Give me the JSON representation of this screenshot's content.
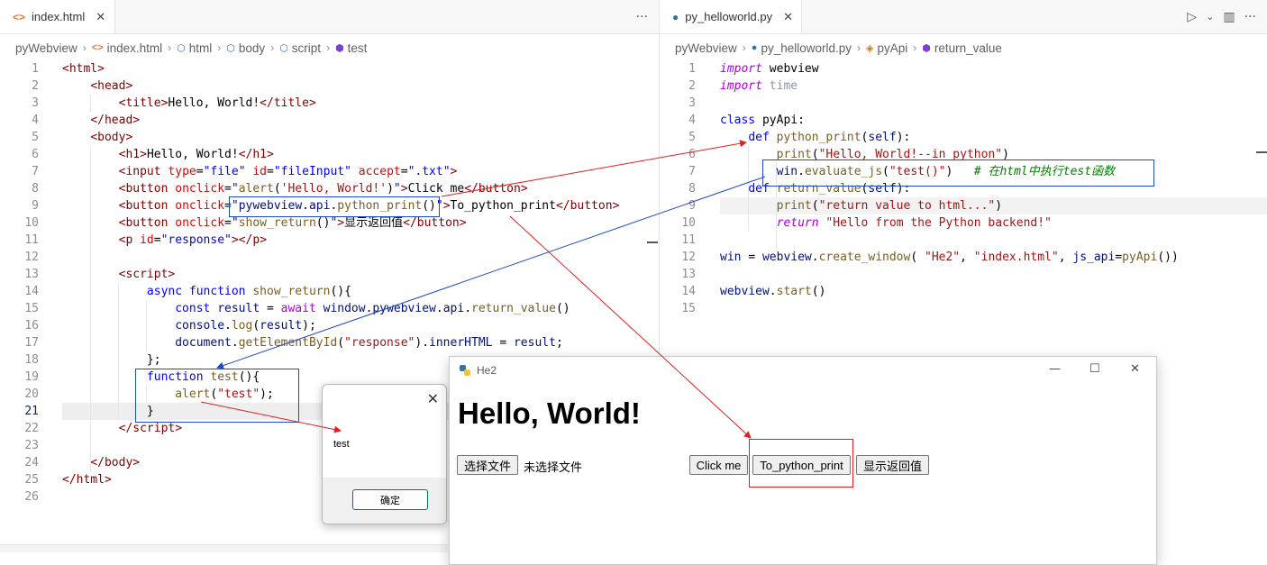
{
  "left_editor": {
    "tab": {
      "icon": "html-file-icon",
      "label": "index.html",
      "close": "✕"
    },
    "more_actions": "···",
    "breadcrumb": [
      "pyWebview",
      "index.html",
      "html",
      "body",
      "script",
      "test"
    ],
    "lines": [
      {
        "n": "1",
        "html": "<span class=\"p\">&lt;</span><span class=\"t\">html</span><span class=\"p\">&gt;</span>"
      },
      {
        "n": "2",
        "html": "    <span class=\"p\">&lt;</span><span class=\"t\">head</span><span class=\"p\">&gt;</span>"
      },
      {
        "n": "3",
        "html": "        <span class=\"p\">&lt;</span><span class=\"t\">title</span><span class=\"p\">&gt;</span><span class=\"d\">Hello, World!</span><span class=\"p\">&lt;/</span><span class=\"t\">title</span><span class=\"p\">&gt;</span>"
      },
      {
        "n": "4",
        "html": "    <span class=\"p\">&lt;/</span><span class=\"t\">head</span><span class=\"p\">&gt;</span>"
      },
      {
        "n": "5",
        "html": "    <span class=\"p\">&lt;</span><span class=\"t\">body</span><span class=\"p\">&gt;</span>"
      },
      {
        "n": "6",
        "html": "        <span class=\"p\">&lt;</span><span class=\"t\">h1</span><span class=\"p\">&gt;</span><span class=\"d\">Hello, World!</span><span class=\"p\">&lt;/</span><span class=\"t\">h1</span><span class=\"p\">&gt;</span>"
      },
      {
        "n": "7",
        "html": "        <span class=\"p\">&lt;</span><span class=\"t\">input</span> <span class=\"a\">type</span><span class=\"d\">=</span><span class=\"k\">\"file\"</span> <span class=\"a\">id</span><span class=\"d\">=</span><span class=\"k\">\"fileInput\"</span> <span class=\"a\">accept</span><span class=\"d\">=</span><span class=\"k\">\".txt\"</span><span class=\"p\">&gt;</span>"
      },
      {
        "n": "8",
        "html": "        <span class=\"p\">&lt;</span><span class=\"t\">button</span> <span class=\"a\">onclick</span><span class=\"d\">=</span><span class=\"k\">\"</span><span class=\"f\">alert</span><span class=\"d\">(</span><span class=\"s\">'Hello, World!'</span><span class=\"d\">)</span><span class=\"k\">\"</span><span class=\"p\">&gt;</span><span class=\"d\">Click me</span><span class=\"p\">&lt;/</span><span class=\"t\">button</span><span class=\"p\">&gt;</span>"
      },
      {
        "n": "9",
        "html": "        <span class=\"p\">&lt;</span><span class=\"t\">button</span> <span class=\"a\">onclick</span><span class=\"d\">=</span><span class=\"k\">\"</span><span class=\"v\">pywebview</span><span class=\"d\">.</span><span class=\"v\">api</span><span class=\"d\">.</span><span class=\"f\">python_print</span><span class=\"d\">()</span><span class=\"k\">\"</span><span class=\"p\">&gt;</span><span class=\"d\">To_python_print</span><span class=\"p\">&lt;/</span><span class=\"t\">button</span><span class=\"p\">&gt;</span>"
      },
      {
        "n": "10",
        "html": "        <span class=\"p\">&lt;</span><span class=\"t\">button</span> <span class=\"a\">onclick</span><span class=\"d\">=</span><span class=\"k\">\"</span><span class=\"f\">show_return</span><span class=\"d\">()</span><span class=\"k\">\"</span><span class=\"p\">&gt;</span><span class=\"d\">显示返回值</span><span class=\"p\">&lt;/</span><span class=\"t\">button</span><span class=\"p\">&gt;</span>"
      },
      {
        "n": "11",
        "html": "        <span class=\"p\">&lt;</span><span class=\"t\">p</span> <span class=\"a\">id</span><span class=\"d\">=</span><span class=\"k\">\"response\"</span><span class=\"p\">&gt;&lt;/</span><span class=\"t\">p</span><span class=\"p\">&gt;</span>"
      },
      {
        "n": "12",
        "html": ""
      },
      {
        "n": "13",
        "html": "        <span class=\"p\">&lt;</span><span class=\"t\">script</span><span class=\"p\">&gt;</span>"
      },
      {
        "n": "14",
        "html": "            <span class=\"k\">async</span> <span class=\"k\">function</span> <span class=\"f\">show_return</span><span class=\"d\">(){</span>"
      },
      {
        "n": "15",
        "html": "                <span class=\"k\">const</span> <span class=\"v\">result</span> <span class=\"d\">=</span> <span class=\"kp\" style=\"font-style:normal\">await</span> <span class=\"v\">window</span><span class=\"d\">.</span><span class=\"v\">pywebview</span><span class=\"d\">.</span><span class=\"v\">api</span><span class=\"d\">.</span><span class=\"f\">return_value</span><span class=\"d\">()</span>"
      },
      {
        "n": "16",
        "html": "                <span class=\"v\">console</span><span class=\"d\">.</span><span class=\"f\">log</span><span class=\"d\">(</span><span class=\"v\">result</span><span class=\"d\">);</span>"
      },
      {
        "n": "17",
        "html": "                <span class=\"v\">document</span><span class=\"d\">.</span><span class=\"f\">getElementById</span><span class=\"d\">(</span><span class=\"s\">\"response\"</span><span class=\"d\">).</span><span class=\"v\">innerHTML</span> <span class=\"d\">=</span> <span class=\"v\">result</span><span class=\"d\">;</span>"
      },
      {
        "n": "18",
        "html": "            <span class=\"d\">};</span>"
      },
      {
        "n": "19",
        "html": "            <span class=\"k\">function</span> <span class=\"f\">test</span><span class=\"d\">(){</span>"
      },
      {
        "n": "20",
        "html": "                <span class=\"f\">alert</span><span class=\"d\">(</span><span class=\"s\">\"test\"</span><span class=\"d\">);</span>"
      },
      {
        "n": "21",
        "html": "            <span class=\"d\">}</span>"
      },
      {
        "n": "22",
        "html": "        <span class=\"p\">&lt;/</span><span class=\"t\">script</span><span class=\"p\">&gt;</span>"
      },
      {
        "n": "23",
        "html": ""
      },
      {
        "n": "24",
        "html": "    <span class=\"p\">&lt;/</span><span class=\"t\">body</span><span class=\"p\">&gt;</span>"
      },
      {
        "n": "25",
        "html": "<span class=\"p\">&lt;/</span><span class=\"t\">html</span><span class=\"p\">&gt;</span>"
      },
      {
        "n": "26",
        "html": ""
      }
    ]
  },
  "right_editor": {
    "tab": {
      "icon": "python-file-icon",
      "label": "py_helloworld.py",
      "close": "✕"
    },
    "run_icon": "▷",
    "run_menu": "⌄",
    "split_icon": "▥",
    "more_actions": "···",
    "breadcrumb": [
      "pyWebview",
      "py_helloworld.py",
      "pyApi",
      "return_value"
    ],
    "lines": [
      {
        "n": "1",
        "html": "<span class=\"kp\">import</span> <span class=\"d\">webview</span>"
      },
      {
        "n": "2",
        "html": "<span class=\"kp\">import</span> <span style=\"color:#8a94a6\">time</span>"
      },
      {
        "n": "3",
        "html": ""
      },
      {
        "n": "4",
        "html": "<span class=\"k\">class</span> <span class=\"d\">pyApi:</span>"
      },
      {
        "n": "5",
        "html": "    <span class=\"k\">def</span> <span class=\"f\">python_print</span><span class=\"d\">(</span><span class=\"v\">self</span><span class=\"d\">):</span>"
      },
      {
        "n": "6",
        "html": "        <span class=\"f\">print</span><span class=\"d\">(</span><span class=\"s\">\"Hello, World!--in python\"</span><span class=\"d\">)</span>"
      },
      {
        "n": "7",
        "html": "        <span class=\"v\">win</span><span class=\"d\">.</span><span class=\"f\">evaluate_js</span><span class=\"d\">(</span><span class=\"s\">\"test()\"</span><span class=\"d\">)</span>   <span class=\"cm\"># 在html中执行test函数</span>"
      },
      {
        "n": "8",
        "html": "    <span class=\"k\">def</span> <span class=\"f\">return_value</span><span class=\"d\">(</span><span class=\"v\">self</span><span class=\"d\">):</span>"
      },
      {
        "n": "9",
        "html": "        <span class=\"f\">print</span><span class=\"d\">(</span><span class=\"s\">\"return value to html...\"</span><span class=\"d\">)</span>"
      },
      {
        "n": "10",
        "html": "        <span class=\"kp\">return</span> <span class=\"s\">\"Hello from the Python backend!\"</span>"
      },
      {
        "n": "11",
        "html": ""
      },
      {
        "n": "12",
        "html": "<span class=\"v\">win</span> <span class=\"d\">=</span> <span class=\"v\">webview</span><span class=\"d\">.</span><span class=\"f\">create_window</span><span class=\"d\">(</span> <span class=\"s\">\"He2\"</span><span class=\"d\">,</span> <span class=\"s\">\"index.html\"</span><span class=\"d\">,</span> <span class=\"v\">js_api</span><span class=\"d\">=</span><span class=\"f\">pyApi</span><span class=\"d\">())</span>"
      },
      {
        "n": "13",
        "html": ""
      },
      {
        "n": "14",
        "html": "<span class=\"v\">webview</span><span class=\"d\">.</span><span class=\"f\">start</span><span class=\"d\">()</span>"
      },
      {
        "n": "15",
        "html": ""
      }
    ]
  },
  "alert_dialog": {
    "message": "test",
    "ok_label": "确定",
    "close": "✕"
  },
  "webview_window": {
    "title": "He2",
    "minimize": "—",
    "maximize": "☐",
    "close": "✕",
    "heading": "Hello, World!",
    "choose_file_label": "选择文件",
    "no_file_text": "未选择文件",
    "click_me_label": "Click me",
    "to_python_label": "To_python_print",
    "show_return_label": "显示返回值"
  },
  "colors": {
    "annotation_red": "#e02020",
    "annotation_blue": "#1f4bc2",
    "current_line": "#eeeeee"
  }
}
